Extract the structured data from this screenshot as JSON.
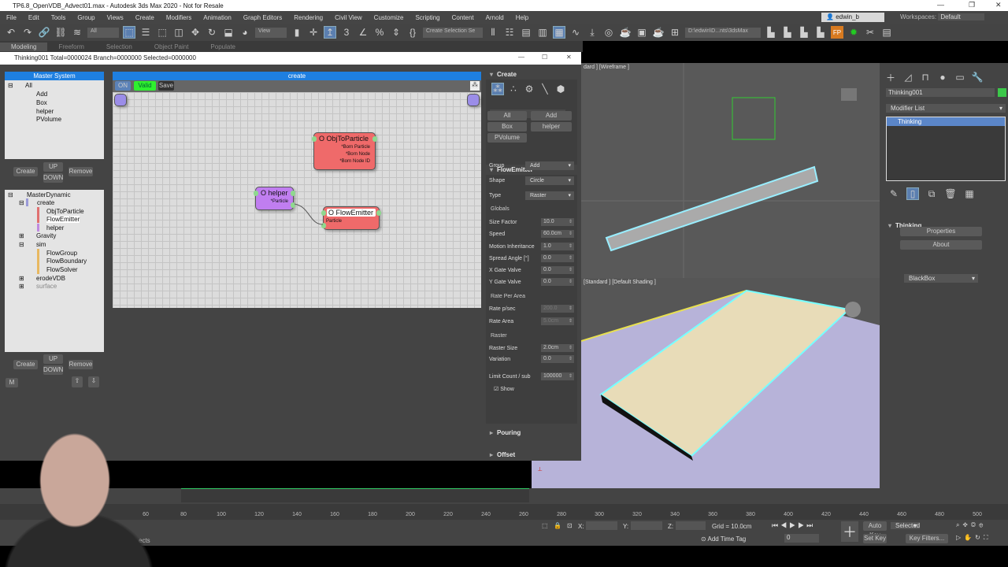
{
  "app": {
    "title": "TP6.8_OpenVDB_Advect01.max - Autodesk 3ds Max 2020 - Not for Resale",
    "user": "edwin_b",
    "workspaces_label": "Workspaces:",
    "workspace": "Default"
  },
  "menu": [
    "File",
    "Edit",
    "Tools",
    "Group",
    "Views",
    "Create",
    "Modifiers",
    "Animation",
    "Graph Editors",
    "Rendering",
    "Civil View",
    "Customize",
    "Scripting",
    "Content",
    "Arnold",
    "Help"
  ],
  "toolbar": {
    "filter": "All",
    "view": "View",
    "selection_set": "Create Selection Se",
    "path": "D:\\edwin\\D...nts\\3dsMax"
  },
  "ribbon_tabs": [
    "Modeling",
    "Freeform",
    "Selection",
    "Object Paint",
    "Populate"
  ],
  "thinking_window": {
    "title": "Thinking001  Total=0000024  Branch=0000000  Selected=0000000",
    "master_system": {
      "header": "Master System",
      "root": "All",
      "items": [
        "Add",
        "Box",
        "helper",
        "PVolume"
      ],
      "create": "Create",
      "up": "UP",
      "down": "DOWN",
      "remove": "Remove"
    },
    "dynamic_tree": {
      "root": "MasterDynamic",
      "nodes": [
        {
          "label": "create",
          "level": 1
        },
        {
          "label": "ObjToParticle",
          "level": 2
        },
        {
          "label": "FlowEmitter",
          "level": 2
        },
        {
          "label": "helper",
          "level": 2
        },
        {
          "label": "Gravity",
          "level": 1
        },
        {
          "label": "sim",
          "level": 1
        },
        {
          "label": "FlowGroup",
          "level": 2
        },
        {
          "label": "FlowBoundary",
          "level": 2
        },
        {
          "label": "FlowSolver",
          "level": 2
        },
        {
          "label": "erodeVDB",
          "level": 1
        },
        {
          "label": "surface",
          "level": 1
        }
      ],
      "create": "Create",
      "up": "UP",
      "down": "DOWN",
      "remove": "Remove",
      "m": "M"
    },
    "graph": {
      "header": "create",
      "on": "ON",
      "valid": "Valid",
      "save": "Save",
      "nodes": {
        "obj": {
          "title": "O ObjToParticle",
          "ports": [
            "*Born Particle",
            "*Born Node",
            "*Born Node ID"
          ]
        },
        "helper": {
          "title": "O helper",
          "ports": [
            "*Particle"
          ]
        },
        "emitter": {
          "title": "O FlowEmitter",
          "ports": [
            "Particle"
          ]
        }
      }
    },
    "params": {
      "create_header": "Create",
      "create_buttons": [
        "All",
        "Add",
        "Box",
        "helper",
        "PVolume"
      ],
      "emitter_header": "FlowEmitter",
      "group_label": "Group",
      "group": "Add",
      "shape_label": "Shape",
      "shape": "Circle",
      "type_label": "Type",
      "type": "Raster",
      "globals": "Globals",
      "globals_rows": [
        {
          "label": "Size Factor",
          "value": "10.0"
        },
        {
          "label": "Speed",
          "value": "60.0cm"
        },
        {
          "label": "Motion Inheritance",
          "value": "1.0"
        },
        {
          "label": "Spread Angle [°]",
          "value": "0.0"
        },
        {
          "label": "X Gate Valve",
          "value": "0.0"
        },
        {
          "label": "Y Gate Valve",
          "value": "0.0"
        }
      ],
      "rate_group": "Rate Per Area",
      "rate_rows": [
        {
          "label": "Rate p/sec",
          "value": "200.0"
        },
        {
          "label": "Rate Area",
          "value": "5.0cm"
        }
      ],
      "raster_group": "Raster",
      "raster_rows": [
        {
          "label": "Raster Size",
          "value": "2.0cm"
        },
        {
          "label": "Variation",
          "value": "0.0"
        }
      ],
      "limit_label": "Limit Count / sub",
      "limit": "100000",
      "show": "Show",
      "pouring": "Pouring",
      "offset": "Offset"
    }
  },
  "viewports": {
    "top_label": "dard ] [Wireframe ]",
    "bottom_label": "[Standard ] [Default Shading ]"
  },
  "command_panel": {
    "object_name": "Thinking001",
    "object_color": "#3cc84a",
    "modifier_list": "Modifier List",
    "stack": [
      "Thinking"
    ],
    "rollout": "Thinking",
    "properties": "Properties",
    "about": "About",
    "blackbox": "BlackBox"
  },
  "timeline": {
    "ticks": [
      60,
      80,
      100,
      120,
      140,
      160,
      180,
      200,
      220,
      240,
      260,
      280,
      300,
      320,
      340,
      360,
      380,
      400,
      420,
      440,
      460,
      480,
      500
    ]
  },
  "status": {
    "x": "X:",
    "y": "Y:",
    "z": "Z:",
    "grid": "Grid = 10.0cm",
    "add_time_tag": "Add Time Tag",
    "frame": "0",
    "auto_key": "Auto Key",
    "selected": "Selected",
    "set_key": "Set Key",
    "key_filters": "Key Filters...",
    "objects": "ects"
  }
}
